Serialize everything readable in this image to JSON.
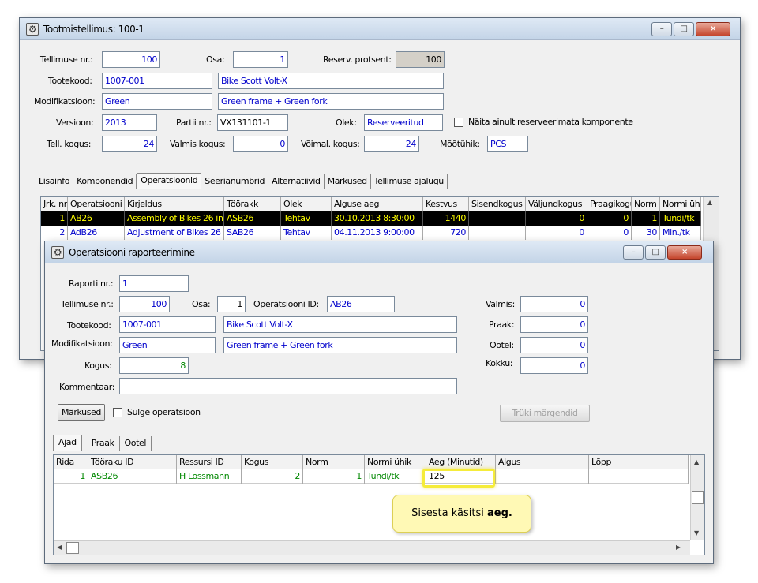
{
  "w1": {
    "title": "Tootmistellimus: 100-1",
    "controls": {
      "minimize": "–",
      "maximize": "□",
      "close": "×"
    },
    "labels": {
      "order_no": "Tellimuse nr.:",
      "part": "Osa:",
      "reserve_pct": "Reserv. protsent:",
      "product_code": "Tootekood:",
      "modification": "Modifikatsioon:",
      "version": "Versioon:",
      "batch": "Partii nr.:",
      "status": "Olek:",
      "only_unreserved": "Näita ainult reserveerimata komponente",
      "order_qty": "Tell. kogus:",
      "done_qty": "Valmis kogus:",
      "possible_qty": "Võimal. kogus:",
      "unit": "Mõõtühik:"
    },
    "values": {
      "order_no": "100",
      "part": "1",
      "reserve_pct": "100",
      "product_code": "1007-001",
      "product_name": "Bike Scott Volt-X",
      "modification": "Green",
      "modification_name": "Green frame + Green fork",
      "version": "2013",
      "batch": "VX131101-1",
      "status": "Reserveeritud",
      "order_qty": "24",
      "done_qty": "0",
      "possible_qty": "24",
      "unit": "PCS"
    },
    "tabs": [
      "Lisainfo",
      "Komponendid",
      "Operatsioonid",
      "Seerianumbrid",
      "Alternatiivid",
      "Märkused",
      "Tellimuse ajalugu"
    ],
    "grid": {
      "columns": [
        "Jrk. nr",
        "Operatsiooni",
        "Kirjeldus",
        "Töörakk",
        "Olek",
        "Alguse aeg",
        "Kestvus",
        "Sisendkogus",
        "Väljundkogus",
        "Praagikogus",
        "Norm",
        "Normi ühik"
      ],
      "rows": [
        [
          "1",
          "AB26",
          "Assembly of Bikes 26 in",
          "ASB26",
          "Tehtav",
          "30.10.2013 8:30:00",
          "1440",
          "",
          "0",
          "0",
          "1",
          "Tundi/tk"
        ],
        [
          "2",
          "AdB26",
          "Adjustment of Bikes 26",
          "SAB26",
          "Tehtav",
          "04.11.2013 9:00:00",
          "720",
          "",
          "0",
          "0",
          "30",
          "Min./tk"
        ]
      ]
    }
  },
  "w2": {
    "title": "Operatsiooni raporteerimine",
    "controls": {
      "minimize": "–",
      "maximize": "□",
      "close": "×"
    },
    "labels": {
      "report_no": "Raporti nr.:",
      "order_no": "Tellimuse nr.:",
      "part": "Osa:",
      "operation_id": "Operatsiooni ID:",
      "product_code": "Tootekood:",
      "modification": "Modifikatsioon:",
      "qty": "Kogus:",
      "comment": "Kommentaar:",
      "done": "Valmis:",
      "scrap": "Praak:",
      "waiting": "Ootel:",
      "total": "Kokku:"
    },
    "values": {
      "report_no": "1",
      "order_no": "100",
      "part": "1",
      "operation_id": "AB26",
      "product_code": "1007-001",
      "product_name": "Bike Scott Volt-X",
      "modification": "Green",
      "modification_name": "Green frame + Green fork",
      "qty": "8",
      "comment": "",
      "done": "0",
      "scrap": "0",
      "waiting": "0",
      "total": "0"
    },
    "buttons": {
      "notes": "Märkused",
      "close_op": "Sulge operatsioon",
      "print_labels": "Trüki märgendid"
    },
    "tabs": [
      "Ajad",
      "Praak",
      "Ootel"
    ],
    "grid": {
      "columns": [
        "Rida",
        "Tööraku ID",
        "Ressursi ID",
        "Kogus",
        "Norm",
        "Normi ühik",
        "Aeg (Minutid)",
        "Algus",
        "Lõpp"
      ],
      "rows": [
        [
          "1",
          "ASB26",
          "H Lossmann",
          "2",
          "1",
          "Tundi/tk",
          "125",
          "",
          ""
        ]
      ]
    }
  },
  "callout": {
    "text": "Sisesta käsitsi ",
    "bold": "aeg."
  },
  "colors": {
    "selected_row_bg": "#000000",
    "selected_row_fg": "#ffff00",
    "row_fg": "#0000cc",
    "report_row_fg": "#008000",
    "callout_bg": "#fff9b5"
  }
}
